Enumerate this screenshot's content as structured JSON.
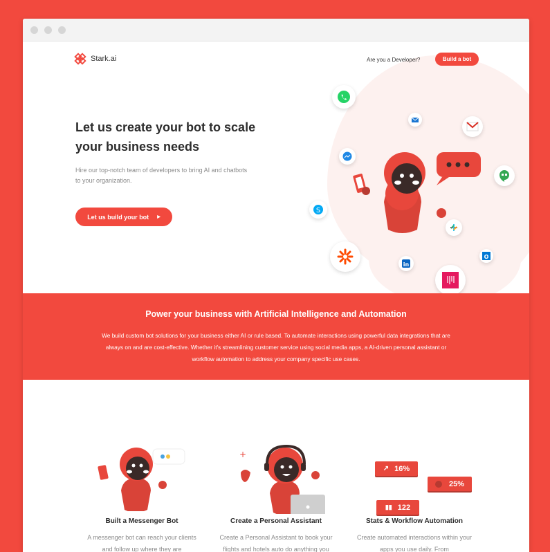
{
  "brand": {
    "name": "Stark.ai"
  },
  "nav": {
    "developer_link": "Are you a Developer?",
    "build_button": "Build a bot"
  },
  "hero": {
    "title": "Let us create your bot to scale your business needs",
    "subtitle": "Hire our top-notch team of developers to bring AI and chatbots to your organization.",
    "cta": "Let us build your bot"
  },
  "band": {
    "title": "Power your business with Artificial Intelligence and Automation",
    "text": "We build custom bot solutions for your business either AI or rule based. To automate interactions using powerful data integrations that are always on and are cost-effective. Whether it's  streamlining customer service using social media apps, a AI-driven personal assistant or workflow automation to address your company specific use cases."
  },
  "features": [
    {
      "title": "Built a Messenger Bot",
      "desc": "A messenger bot can reach your clients and follow up where they are"
    },
    {
      "title": "Create a Personal Assistant",
      "desc": "Create a Personal Assistant to book your flights and hotels auto do anything you"
    },
    {
      "title": "Stats & Workflow Automation",
      "desc": "Create automated interactions within your apps you use daily. From"
    }
  ],
  "stats": [
    {
      "value": "16%",
      "icon": "trend-up-icon"
    },
    {
      "value": "25%",
      "icon": "dot-icon"
    },
    {
      "value": "122",
      "icon": "bar-chart-icon"
    }
  ],
  "colors": {
    "accent": "#f2493e",
    "text": "#2c2c2c",
    "muted": "#8a8a8a"
  }
}
